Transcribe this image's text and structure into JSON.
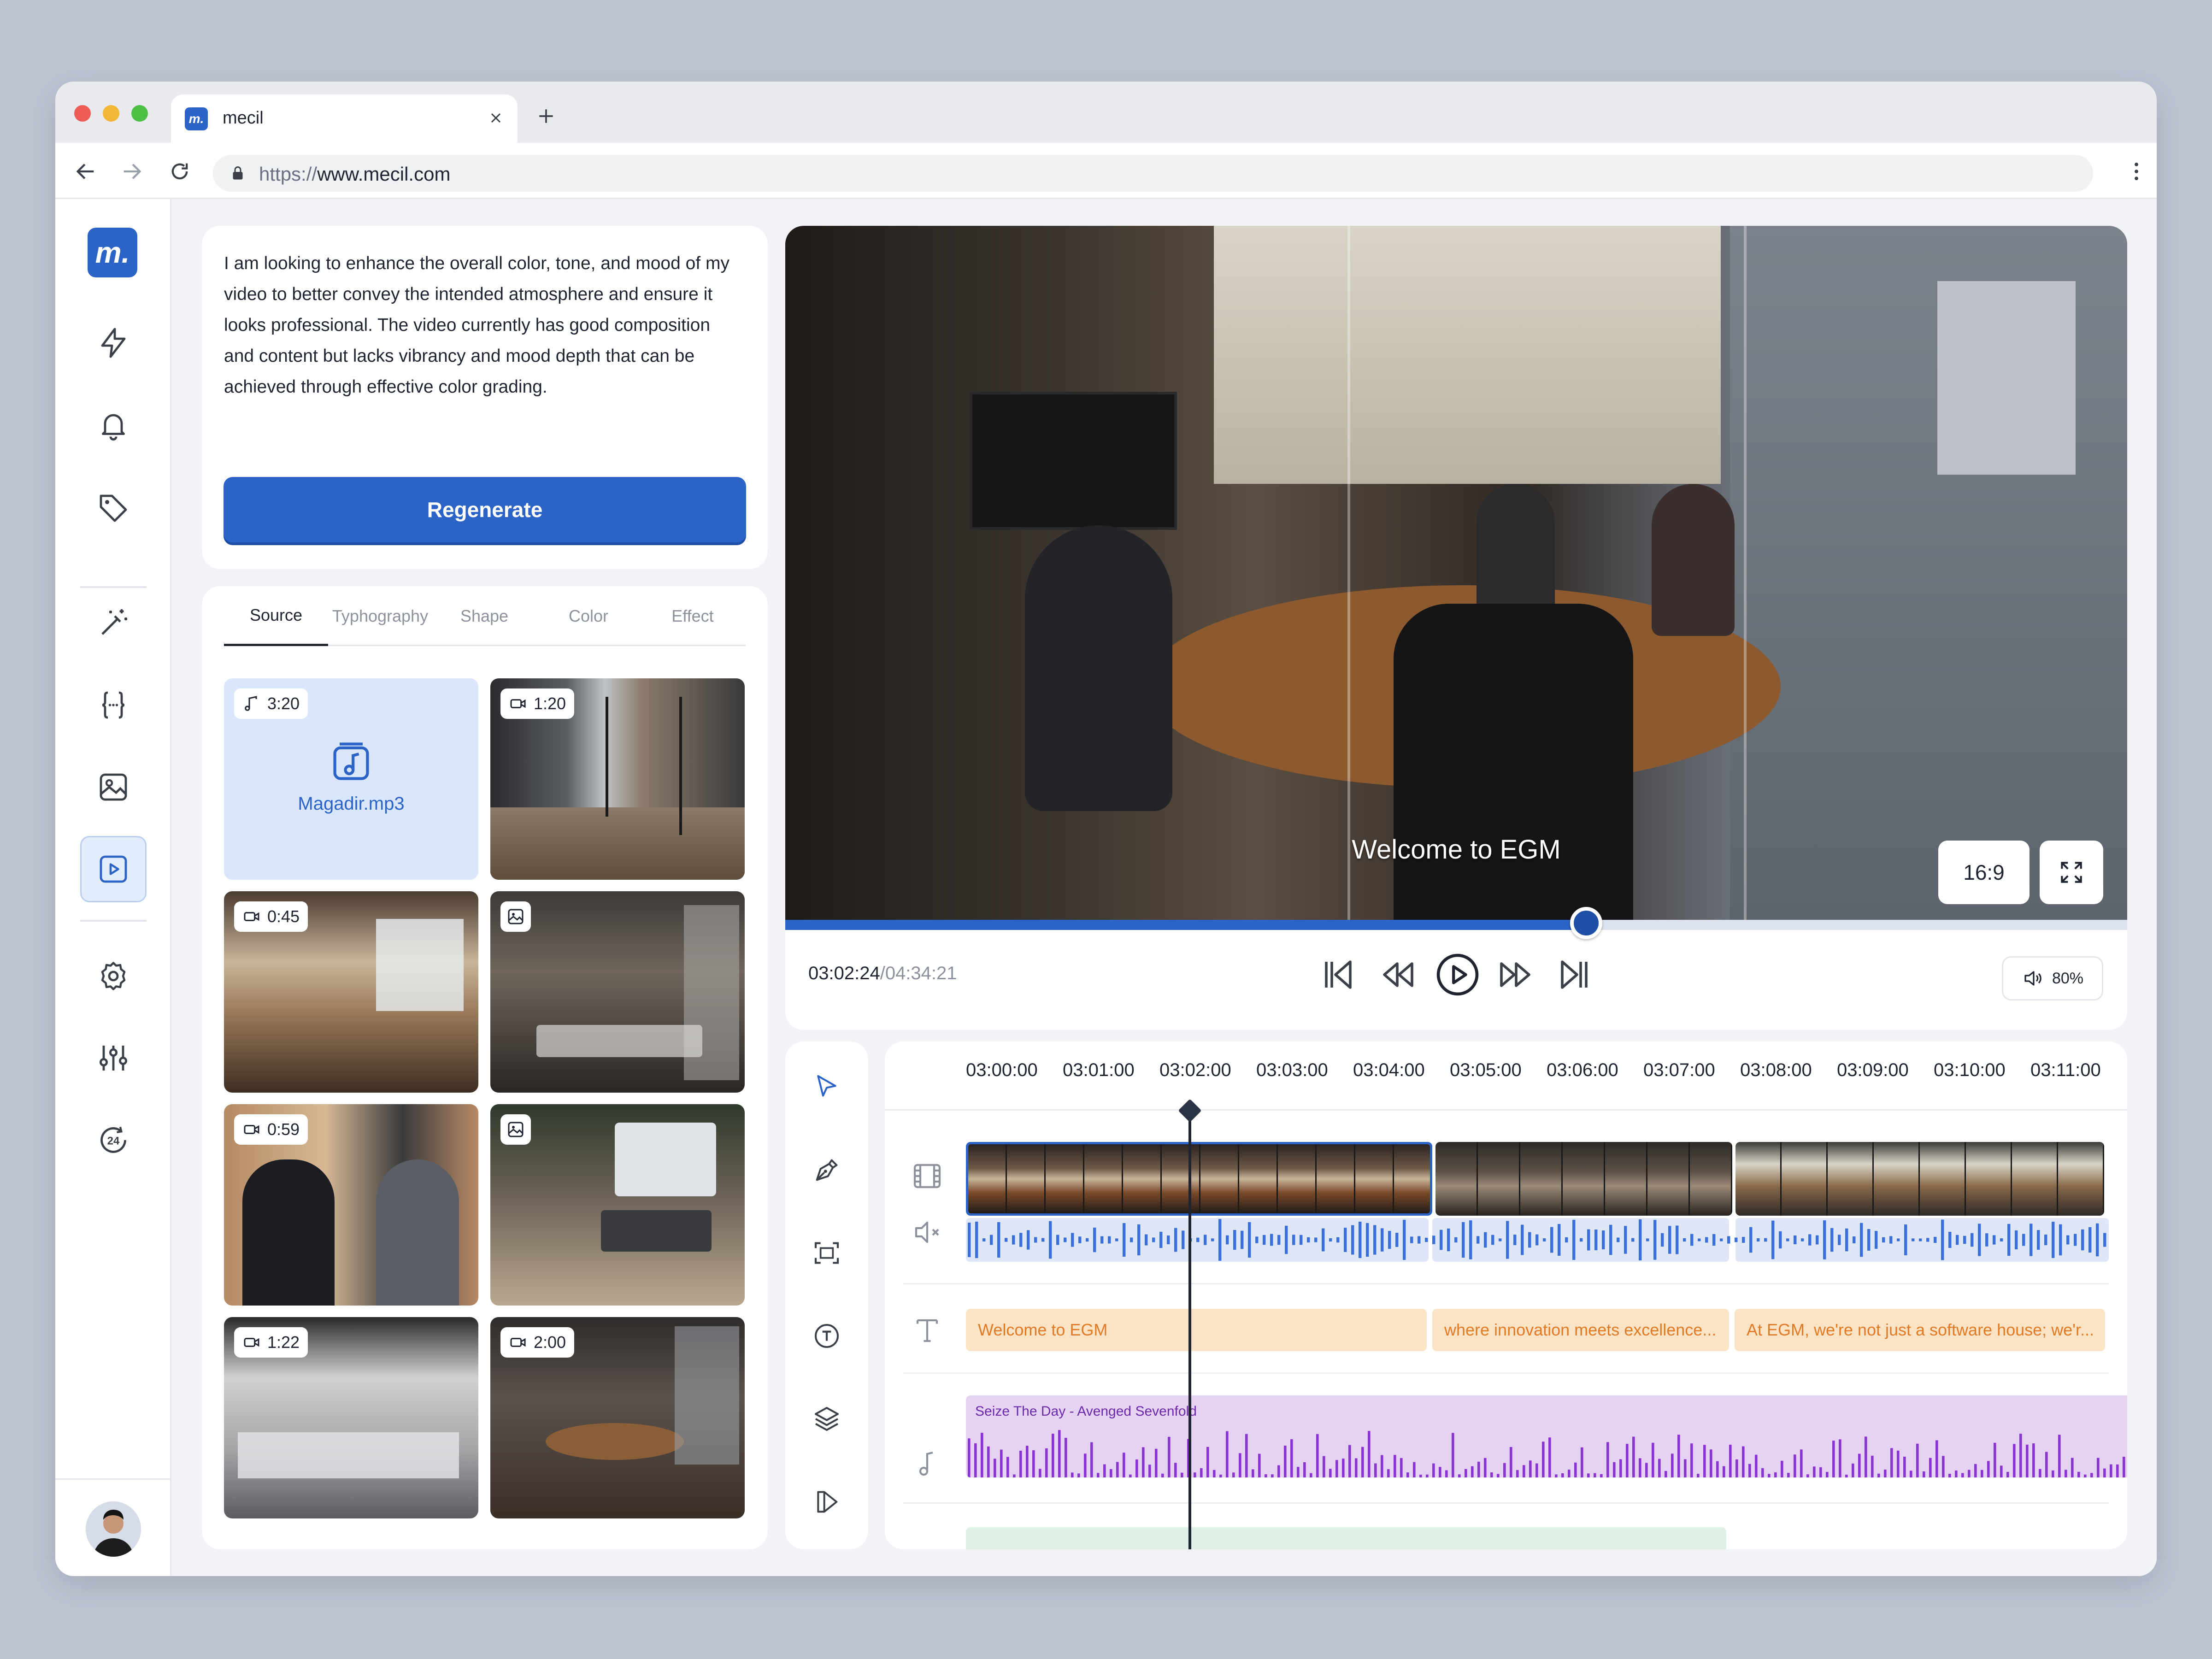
{
  "browser": {
    "tab_title": "mecil",
    "url_scheme": "https://",
    "url_host": "www.mecil.com",
    "logo_letter": "m."
  },
  "sidebar": {
    "items": [
      {
        "name": "lightning-icon",
        "active": false
      },
      {
        "name": "bell-icon",
        "active": false
      },
      {
        "name": "tag-icon",
        "active": false
      },
      {
        "name": "magic-wand-icon",
        "active": false
      },
      {
        "name": "code-braces-icon",
        "active": false
      },
      {
        "name": "image-icon",
        "active": false
      },
      {
        "name": "video-icon",
        "active": true
      },
      {
        "name": "gear-icon",
        "active": false
      },
      {
        "name": "sliders-icon",
        "active": false
      },
      {
        "name": "clock-24-icon",
        "active": false
      }
    ]
  },
  "prompt": {
    "text": "I am looking to enhance the overall color, tone, and mood of my video to better convey the intended atmosphere and ensure it looks professional. The video currently has good composition and content but lacks vibrancy and mood depth that can be achieved through effective color grading.",
    "regenerate_label": "Regenerate"
  },
  "library": {
    "tabs": [
      "Source",
      "Typhography",
      "Shape",
      "Color",
      "Effect"
    ],
    "active_tab": 0,
    "items": [
      {
        "type": "audio",
        "duration": "3:20",
        "filename": "Magadir.mp3"
      },
      {
        "type": "video",
        "duration": "1:20"
      },
      {
        "type": "video",
        "duration": "0:45"
      },
      {
        "type": "image"
      },
      {
        "type": "video",
        "duration": "0:59"
      },
      {
        "type": "image"
      },
      {
        "type": "video",
        "duration": "1:22"
      },
      {
        "type": "video",
        "duration": "2:00"
      }
    ]
  },
  "player": {
    "caption": "Welcome to EGM",
    "aspect_ratio": "16:9",
    "current_time": "03:02:24",
    "total_time": "/04:34:21",
    "progress": 0.597,
    "volume": "80%"
  },
  "timeline": {
    "ticks": [
      "03:00:00",
      "03:01:00",
      "03:02:00",
      "03:03:00",
      "03:04:00",
      "03:05:00",
      "03:06:00",
      "03:07:00",
      "03:08:00",
      "03:09:00",
      "03:10:00",
      "03:11:00"
    ],
    "playhead_time": "03:02:00",
    "text_clips": [
      "Welcome to EGM",
      "where innovation meets excellence...",
      "At EGM, we're not just a software house; we'r..."
    ],
    "audio_track": "Seize The Day - Avenged Sevenfold",
    "tools": [
      "cursor-icon",
      "pen-icon",
      "crop-icon",
      "text-circle-icon",
      "layers-icon",
      "shape-icon"
    ]
  },
  "colors": {
    "primary": "#2b63c6",
    "active_bg": "#e3ecfb",
    "waveform_blue": "#3b6fd4",
    "waveform_purple": "#8a35d1",
    "text_clip_bg": "#fbe3c6",
    "text_clip_fg": "#e07a24",
    "audio_clip_bg": "#e6d2f3"
  }
}
